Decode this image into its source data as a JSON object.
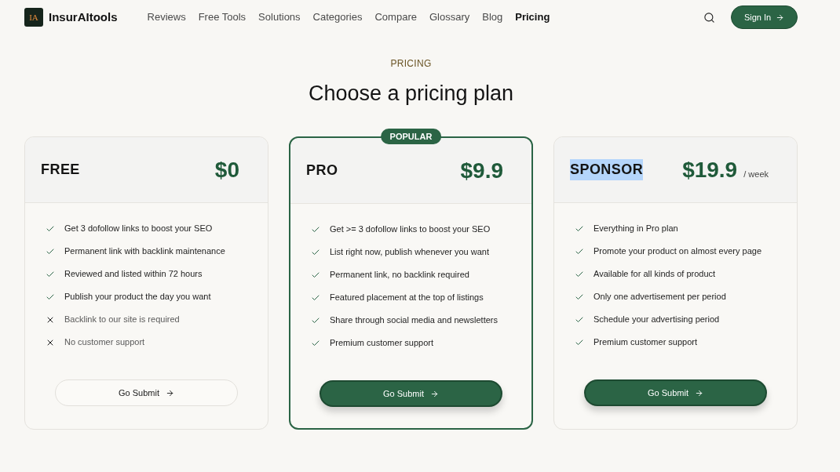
{
  "nav": {
    "logo_mark": "IA",
    "brand": "InsurAItools",
    "links": [
      {
        "label": "Reviews",
        "selected": false
      },
      {
        "label": "Free Tools",
        "selected": false
      },
      {
        "label": "Solutions",
        "selected": false
      },
      {
        "label": "Categories",
        "selected": false
      },
      {
        "label": "Compare",
        "selected": false
      },
      {
        "label": "Glossary",
        "selected": false
      },
      {
        "label": "Blog",
        "selected": false
      },
      {
        "label": "Pricing",
        "selected": true
      }
    ],
    "sign_in": "Sign In"
  },
  "section": {
    "eyebrow": "PRICING",
    "title": "Choose a pricing plan"
  },
  "plans": [
    {
      "name": "FREE",
      "name_highlighted": false,
      "price": "$0",
      "featured": false,
      "features": [
        {
          "text": "Get 3 dofollow links to boost your SEO",
          "included": true
        },
        {
          "text": "Permanent link with backlink maintenance",
          "included": true
        },
        {
          "text": "Reviewed and listed within 72 hours",
          "included": true
        },
        {
          "text": "Publish your product the day you want",
          "included": true
        },
        {
          "text": "Backlink to our site is required",
          "included": false
        },
        {
          "text": "No customer support",
          "included": false
        }
      ],
      "button": {
        "label": "Go Submit",
        "kind": "outline"
      }
    },
    {
      "name": "PRO",
      "name_highlighted": false,
      "price": "$9.9",
      "featured": true,
      "badge": "POPULAR",
      "features": [
        {
          "text": "Get >= 3 dofollow links to boost your SEO",
          "included": true
        },
        {
          "text": "List right now, publish whenever you want",
          "included": true
        },
        {
          "text": "Permanent link, no backlink required",
          "included": true
        },
        {
          "text": "Featured placement at the top of listings",
          "included": true
        },
        {
          "text": "Share through social media and newsletters",
          "included": true
        },
        {
          "text": "Premium customer support",
          "included": true
        }
      ],
      "button": {
        "label": "Go Submit",
        "kind": "filled"
      }
    },
    {
      "name": "SPONSOR",
      "name_highlighted": true,
      "price": "$19.9",
      "period": "/ week",
      "featured": false,
      "features": [
        {
          "text": "Everything in Pro plan",
          "included": true
        },
        {
          "text": "Promote your product on almost every page",
          "included": true
        },
        {
          "text": "Available for all kinds of product",
          "included": true
        },
        {
          "text": "Only one advertisement per period",
          "included": true
        },
        {
          "text": "Schedule your advertising period",
          "included": true
        },
        {
          "text": "Premium customer support",
          "included": true
        }
      ],
      "button": {
        "label": "Go Submit",
        "kind": "filled"
      }
    }
  ]
}
